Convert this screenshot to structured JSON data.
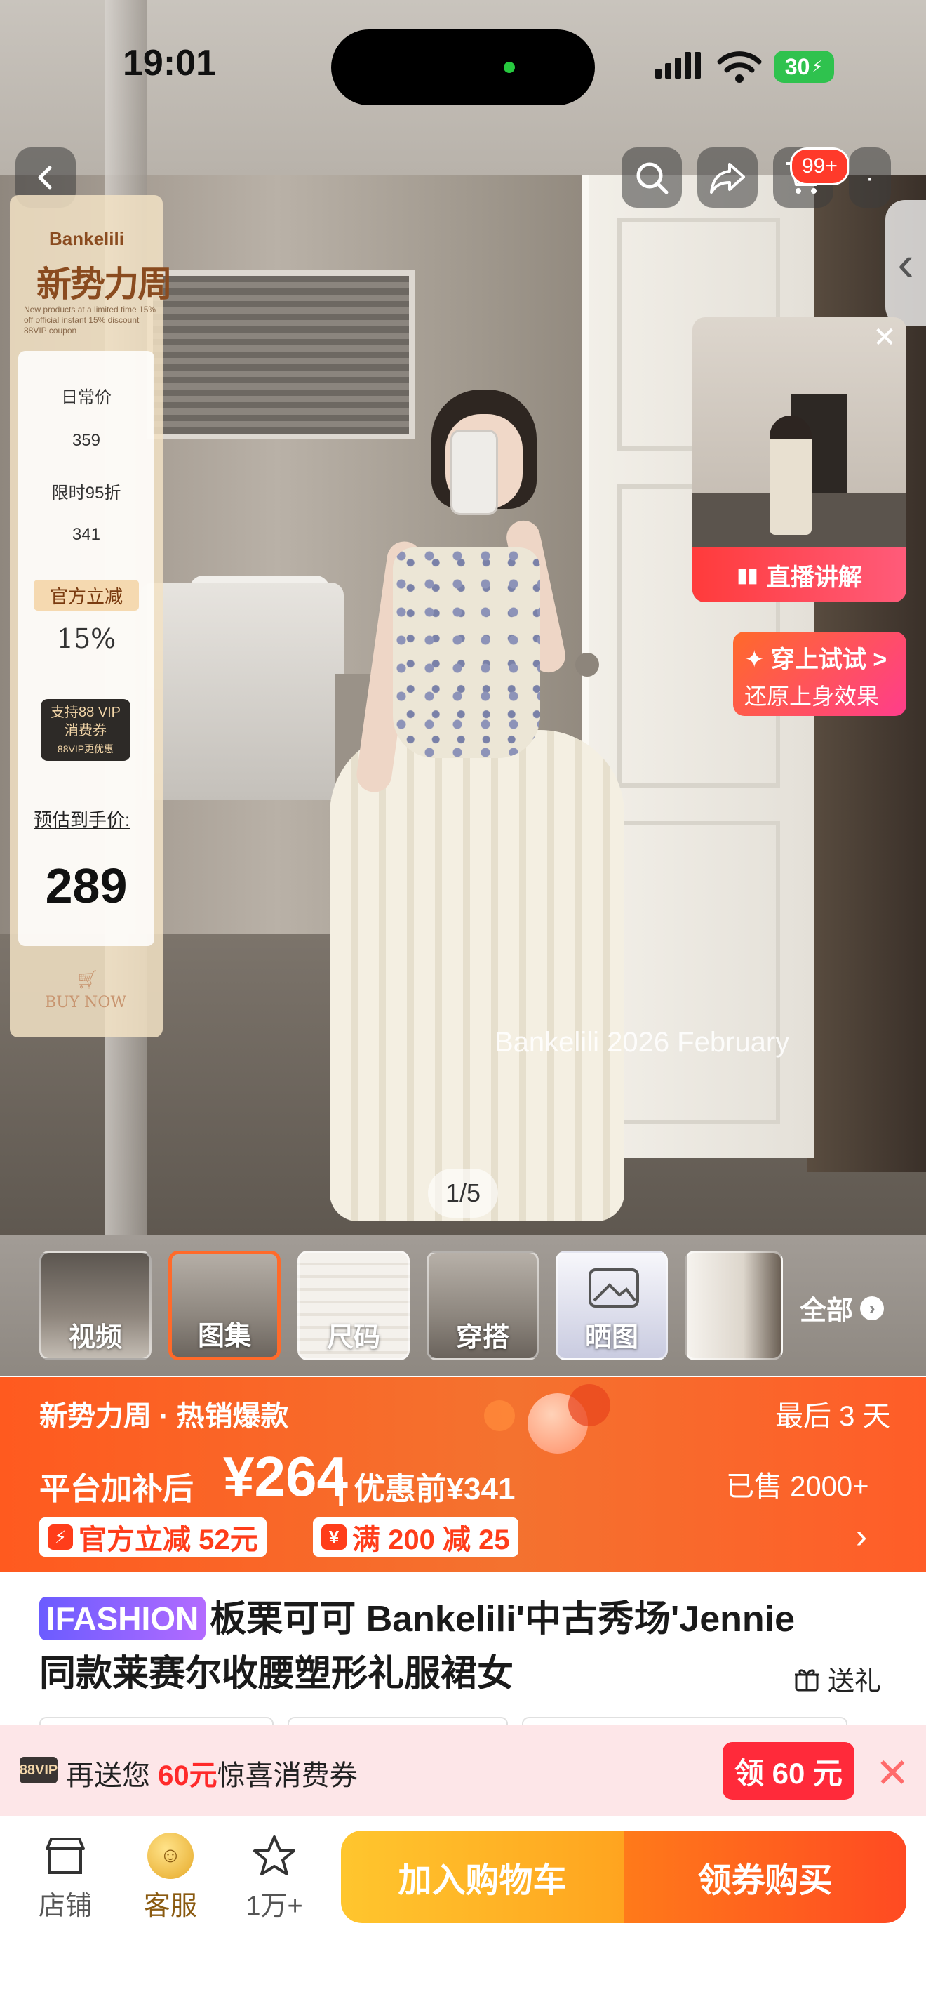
{
  "status_bar": {
    "time": "19:01",
    "battery": "30"
  },
  "header": {
    "cart_badge": "99+"
  },
  "hero": {
    "watermark": "Bankelili 2026 February",
    "counter": "1/5"
  },
  "left_card": {
    "brand": "Bankelili",
    "title": "新势力周",
    "fine_print": "New products at a limited time 15% off official instant 15% discount 88VIP coupon",
    "daily_price_label": "日常价",
    "daily_price": "359",
    "limited_label": "限时95折",
    "limited_price": "341",
    "official_cut_label": "官方立减",
    "official_cut_value": "15%",
    "vip_line1": "支持88 VIP",
    "vip_line2": "消费券",
    "vip_line3": "88VIP更优惠",
    "estimate_label": "预估到手价:",
    "estimate_price": "289",
    "buy_now": "BUY NOW"
  },
  "live_card": {
    "label": "直播讲解"
  },
  "try_on": {
    "title": "✦ 穿上试试 >",
    "subtitle": "还原上身效果"
  },
  "thumbnails": [
    {
      "label": "视频",
      "selected": false
    },
    {
      "label": "图集",
      "selected": true
    },
    {
      "label": "尺码",
      "selected": false
    },
    {
      "label": "穿搭",
      "selected": false
    },
    {
      "label": "晒图",
      "selected": false
    },
    {
      "label": "",
      "selected": false
    }
  ],
  "all_label": "全部",
  "promo": {
    "title": "新势力周 · 热销爆款",
    "days_left": "最后 3 天",
    "price_label": "平台加补后",
    "price": "¥264",
    "original": "| 优惠前¥341",
    "sold": "已售 2000+",
    "chip1": "官方立减 52元",
    "chip2": "满 200 减 25"
  },
  "product": {
    "tag": "IFASHION",
    "title": "板栗可可 Bankelili'中古秀场'Jennie同款莱赛尔收腰塑形礼服裙女",
    "gift": "送礼"
  },
  "vip_banner": {
    "logo": "88VIP",
    "text_pre": "再送您 ",
    "amount": "60元",
    "text_post": "惊喜消费券",
    "button": "领 60 元"
  },
  "bottom_bar": {
    "store": "店铺",
    "service": "客服",
    "favorites": "1万+",
    "add_cart": "加入购物车",
    "buy": "领券购买"
  },
  "colors": {
    "accent": "#ff5a1f",
    "vip_red": "#ff2a3a",
    "cart_yellow": "#ffb224"
  }
}
